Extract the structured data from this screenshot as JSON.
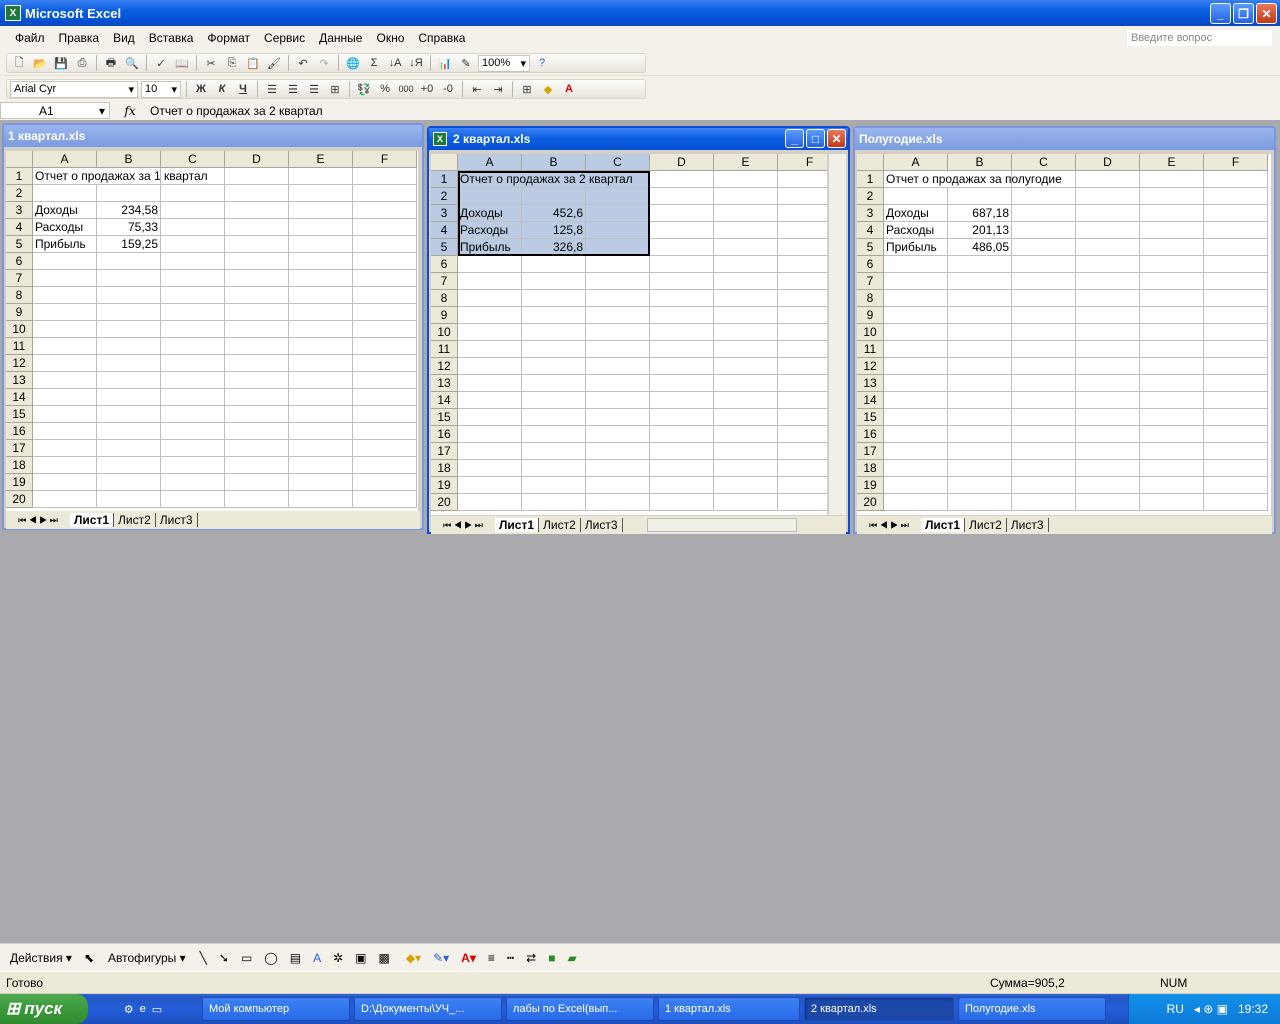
{
  "app": {
    "title": "Microsoft Excel",
    "icon": "excel-app-icon"
  },
  "menu": [
    "Файл",
    "Правка",
    "Вид",
    "Вставка",
    "Формат",
    "Сервис",
    "Данные",
    "Окно",
    "Справка"
  ],
  "ask_placeholder": "Введите вопрос",
  "toolbar_std": {
    "zoom": "100%"
  },
  "toolbar_fmt": {
    "font": "Arial Cyr",
    "size": "10",
    "bold": "Ж",
    "italic": "К",
    "underline": "Ч",
    "percent": "%",
    "thousands": "000"
  },
  "formula": {
    "cell": "A1",
    "fx": "fx",
    "content": "Отчет о продажах за 2 квартал"
  },
  "windows": [
    {
      "title": "1 квартал.xls",
      "active": false,
      "cols": [
        "A",
        "B",
        "C",
        "D",
        "E",
        "F"
      ],
      "rows": [
        "1",
        "2",
        "3",
        "4",
        "5",
        "6",
        "7",
        "8",
        "9",
        "10",
        "11",
        "12",
        "13",
        "14",
        "15",
        "16",
        "17",
        "18",
        "19",
        "20"
      ],
      "cells": [
        [
          "Отчет о продажах за 1 квартал",
          ""
        ],
        [
          "",
          ""
        ],
        [
          "Доходы",
          "234,58"
        ],
        [
          "Расходы",
          "75,33"
        ],
        [
          "Прибыль",
          "159,25"
        ]
      ],
      "tabs": [
        "Лист1",
        "Лист2",
        "Лист3"
      ]
    },
    {
      "title": "2 квартал.xls",
      "active": true,
      "cols": [
        "A",
        "B",
        "C",
        "D",
        "E",
        "F"
      ],
      "rows": [
        "1",
        "2",
        "3",
        "4",
        "5",
        "6",
        "7",
        "8",
        "9",
        "10",
        "11",
        "12",
        "13",
        "14",
        "15",
        "16",
        "17",
        "18",
        "19",
        "20"
      ],
      "cells": [
        [
          "Отчет о продажах за 2 квартал",
          ""
        ],
        [
          "",
          ""
        ],
        [
          "Доходы",
          "452,6"
        ],
        [
          "Расходы",
          "125,8"
        ],
        [
          "Прибыль",
          "326,8"
        ]
      ],
      "tabs": [
        "Лист1",
        "Лист2",
        "Лист3"
      ]
    },
    {
      "title": "Полугодие.xls",
      "active": false,
      "cols": [
        "A",
        "B",
        "C",
        "D",
        "E",
        "F"
      ],
      "rows": [
        "1",
        "2",
        "3",
        "4",
        "5",
        "6",
        "7",
        "8",
        "9",
        "10",
        "11",
        "12",
        "13",
        "14",
        "15",
        "16",
        "17",
        "18",
        "19",
        "20"
      ],
      "cells": [
        [
          "Отчет о продажах за полугодие",
          ""
        ],
        [
          "",
          ""
        ],
        [
          "Доходы",
          "687,18"
        ],
        [
          "Расходы",
          "201,13"
        ],
        [
          "Прибыль",
          "486,05"
        ]
      ],
      "tabs": [
        "Лист1",
        "Лист2",
        "Лист3"
      ]
    }
  ],
  "drawing": {
    "actions": "Действия",
    "autoshapes": "Автофигуры"
  },
  "status": {
    "ready": "Готово",
    "sum": "Сумма=905,2",
    "num": "NUM"
  },
  "taskbar": {
    "start": "пуск",
    "items": [
      "Мой компьютер",
      "D:\\Документы\\УЧ_...",
      "лабы по Excel(вып...",
      "1 квартал.xls",
      "2 квартал.xls",
      "Полугодие.xls"
    ],
    "active_index": 4,
    "lang": "RU",
    "clock": "19:32"
  },
  "colors": {
    "titlebar": "#0a5fe0",
    "selection": "#bccbe4",
    "mdi_background": "#aaa9ad",
    "start_button": "#3b9a3b"
  }
}
